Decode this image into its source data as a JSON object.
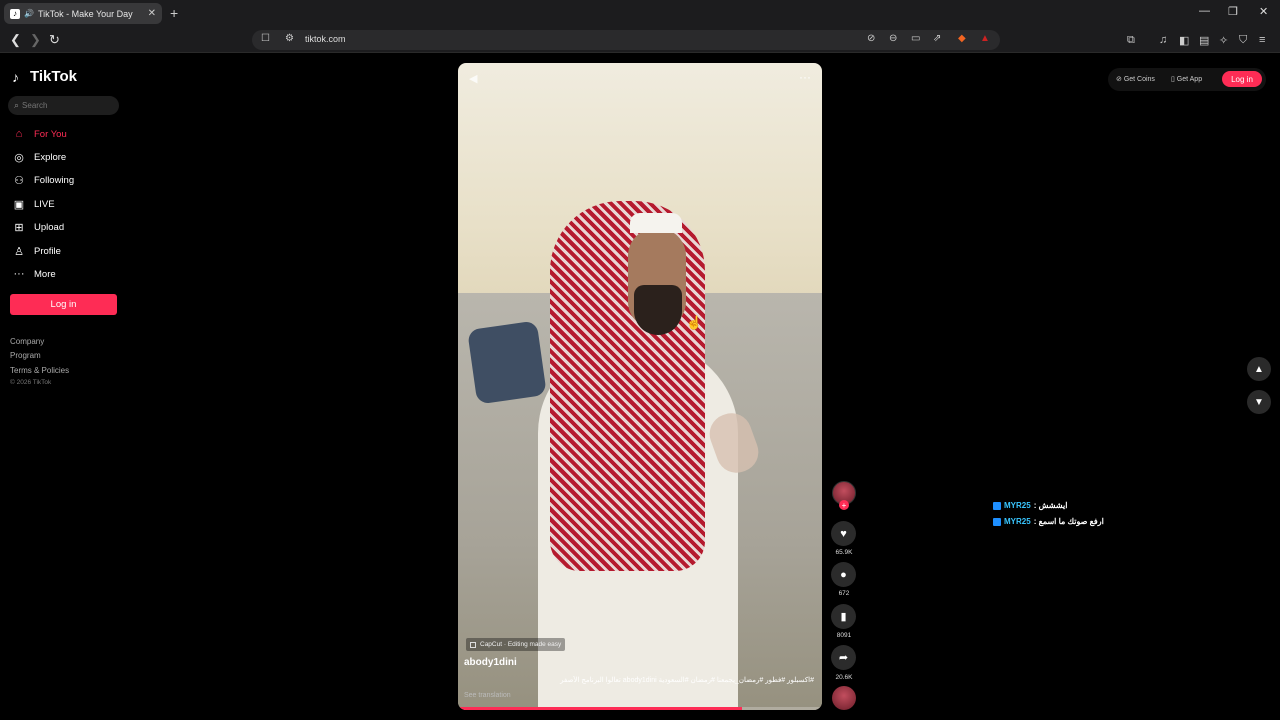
{
  "browser": {
    "tab_title": "TikTok - Make Your Day",
    "tab_close": "✕",
    "new_tab": "+",
    "url": "tiktok.com",
    "window_controls": [
      "—",
      "❐",
      "✕"
    ]
  },
  "sidebar": {
    "logo": "TikTok",
    "search_placeholder": "Search",
    "items": [
      {
        "label": "For You",
        "icon": "home-icon",
        "glyph": "⌂"
      },
      {
        "label": "Explore",
        "icon": "compass-icon",
        "glyph": "◎"
      },
      {
        "label": "Following",
        "icon": "following-icon",
        "glyph": "⚇"
      },
      {
        "label": "LIVE",
        "icon": "live-icon",
        "glyph": "▣"
      },
      {
        "label": "Upload",
        "icon": "upload-icon",
        "glyph": "⊞"
      },
      {
        "label": "Profile",
        "icon": "profile-icon",
        "glyph": "♙"
      },
      {
        "label": "More",
        "icon": "more-icon",
        "glyph": "···"
      }
    ],
    "login_label": "Log in",
    "footer": [
      "Company",
      "Program",
      "Terms & Policies"
    ],
    "copyright": "© 2026 TikTok"
  },
  "topright": {
    "get_coins": "Get Coins",
    "get_app": "Get App",
    "login": "Log in"
  },
  "video": {
    "badge": "CapCut · Editing made easy",
    "author": "abody1dini",
    "description": "#اكسبلور #فطور #رمضان_يجمعنا #رمضان #السعودية abody1dini تعالوا البرنامج الأصفر",
    "see_translation": "See translation",
    "progress": 0.78
  },
  "actions": {
    "likes": "65.9K",
    "comments": "672",
    "saves": "8091",
    "shares": "20.6K"
  },
  "chat": [
    {
      "name": "MYR25",
      "message": ": ايششش"
    },
    {
      "name": "MYR25",
      "message": ": ارفع صوتك ما اسمع"
    }
  ],
  "colors": {
    "accent": "#fe2c55",
    "background": "#000000"
  }
}
